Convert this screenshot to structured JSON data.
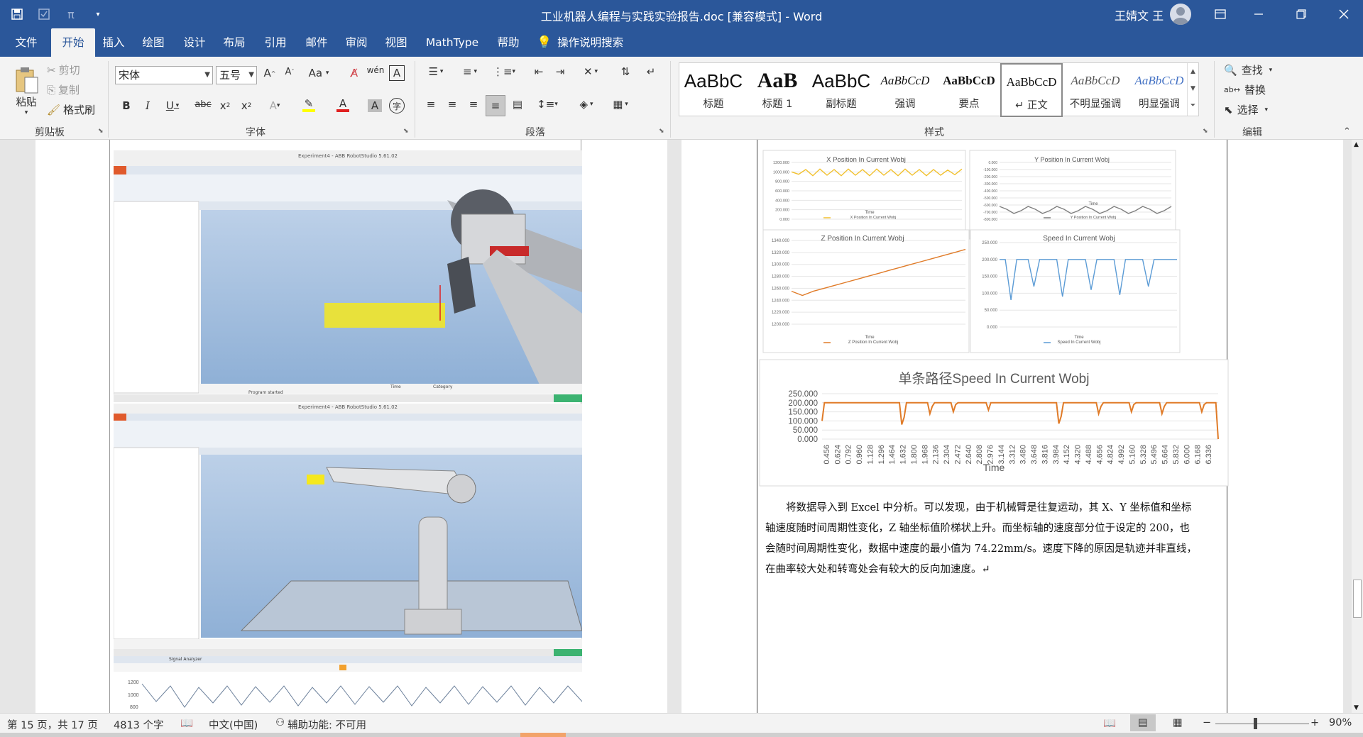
{
  "window": {
    "title": "工业机器人编程与实践实验报告.doc [兼容模式] - Word",
    "user": "王婧文 王",
    "titlebar_color": "#2b579a"
  },
  "menu": [
    "文件",
    "开始",
    "插入",
    "绘图",
    "设计",
    "布局",
    "引用",
    "邮件",
    "审阅",
    "视图",
    "MathType",
    "帮助",
    "操作说明搜索"
  ],
  "ribbon": {
    "clipboard": {
      "paste": "粘贴",
      "cut": "剪切",
      "copy": "复制",
      "format_painter": "格式刷",
      "label": "剪贴板"
    },
    "font": {
      "name": "宋体",
      "size": "五号",
      "label": "字体",
      "change_case": "Aa"
    },
    "paragraph": {
      "label": "段落"
    },
    "styles": {
      "label": "样式",
      "items": [
        {
          "preview": "AaBbC",
          "name": "标题"
        },
        {
          "preview": "AaB",
          "name": "标题 1"
        },
        {
          "preview": "AaBbC",
          "name": "副标题"
        },
        {
          "preview": "AaBbCcD",
          "name": "强调"
        },
        {
          "preview": "AaBbCcD",
          "name": "要点"
        },
        {
          "preview": "AaBbCcD",
          "name": "↵ 正文"
        },
        {
          "preview": "AaBbCcD",
          "name": "不明显强调"
        },
        {
          "preview": "AaBbCcD",
          "name": "明显强调"
        }
      ]
    },
    "editing": {
      "find": "查找",
      "replace": "替换",
      "select": "选择",
      "label": "编辑"
    }
  },
  "left_page": {
    "screenshot1": {
      "title": "Experiment4 - ABB RobotStudio 5.61.02",
      "output_header": [
        "Time",
        "Category"
      ],
      "output_row": "Program started"
    },
    "screenshot2": {
      "title": "Experiment4 - ABB RobotStudio 5.61.02",
      "signal_tab": "Signal Analyzer",
      "y_ticks": [
        "1200",
        "1000",
        "800"
      ]
    }
  },
  "right_page": {
    "charts": [
      {
        "title": "X Position In Current Wobj",
        "legend": "X Position In Current Wobj",
        "xlabel": "Time",
        "y_ticks": [
          "1200.000",
          "1000.000",
          "800.000",
          "600.000",
          "400.000",
          "200.000",
          "0.000"
        ]
      },
      {
        "title": "Y Position In Current Wobj",
        "legend": "Y Position In Current Wobj",
        "xlabel": "Time",
        "y_ticks": [
          "0.000",
          "-100.000",
          "-200.000",
          "-300.000",
          "-400.000",
          "-500.000",
          "-600.000",
          "-700.000",
          "-800.000"
        ]
      },
      {
        "title": "Z Position In Current Wobj",
        "legend": "Z Position In Current Wobj",
        "xlabel": "Time",
        "y_ticks": [
          "1340.000",
          "1320.000",
          "1300.000",
          "1280.000",
          "1260.000",
          "1240.000",
          "1220.000",
          "1200.000"
        ]
      },
      {
        "title": "Speed In Current Wobj",
        "legend": "Speed In Current Wobj",
        "xlabel": "Time",
        "y_ticks": [
          "250.000",
          "200.000",
          "150.000",
          "100.000",
          "50.000",
          "0.000"
        ]
      }
    ],
    "big_chart": {
      "title": "单条路径Speed In Current Wobj",
      "xlabel": "Time",
      "y_ticks": [
        "250.000",
        "200.000",
        "150.000",
        "100.000",
        "50.000",
        "0.000"
      ],
      "x_ticks": [
        "0.456",
        "0.624",
        "0.792",
        "0.960",
        "1.128",
        "1.296",
        "1.464",
        "1.632",
        "1.800",
        "1.968",
        "2.136",
        "2.304",
        "2.472",
        "2.640",
        "2.808",
        "2.976",
        "3.144",
        "3.312",
        "3.480",
        "3.648",
        "3.816",
        "3.984",
        "4.152",
        "4.320",
        "4.488",
        "4.656",
        "4.824",
        "4.992",
        "5.160",
        "5.328",
        "5.496",
        "5.664",
        "5.832",
        "6.000",
        "6.168",
        "6.336"
      ]
    },
    "paragraph": [
      "将数据导入到 Excel 中分析。可以发现，由于机械臂是往复运动，其 X、Y 坐标值和坐标",
      "轴速度随时间周期性变化，Z 轴坐标值阶梯状上升。而坐标轴的速度部分位于设定的 200，也",
      "会随时间周期性变化，数据中速度的最小值为  74.22mm/s。速度下降的原因是轨迹并非直线，",
      "在曲率较大处和转弯处会有较大的反向加速度。↵"
    ]
  },
  "chart_data": [
    {
      "type": "line",
      "title": "X Position In Current Wobj",
      "xlabel": "Time",
      "ylim": [
        0,
        1200
      ],
      "series": [
        {
          "name": "X Position In Current Wobj",
          "color": "#f2c12e",
          "values": [
            1000,
            950,
            1050,
            920,
            1060,
            930,
            1050,
            920,
            1060,
            930,
            1050,
            920,
            1060,
            930,
            1050,
            920,
            1060,
            930,
            1050,
            920,
            1050,
            930,
            1040,
            940,
            1060
          ]
        }
      ]
    },
    {
      "type": "line",
      "title": "Y Position In Current Wobj",
      "xlabel": "Time",
      "ylim": [
        -800,
        0
      ],
      "series": [
        {
          "name": "Y Position In Current Wobj",
          "color": "#7f7f7f",
          "values": [
            -620,
            -660,
            -720,
            -680,
            -620,
            -660,
            -720,
            -680,
            -620,
            -660,
            -720,
            -680,
            -620,
            -660,
            -720,
            -680,
            -620,
            -660,
            -720,
            -680,
            -620,
            -660,
            -720,
            -680,
            -620
          ]
        }
      ]
    },
    {
      "type": "line",
      "title": "Z Position In Current Wobj",
      "xlabel": "Time",
      "ylim": [
        1200,
        1340
      ],
      "series": [
        {
          "name": "Z Position In Current Wobj",
          "color": "#e07b28",
          "values": [
            1255,
            1248,
            1255,
            1260,
            1265,
            1270,
            1275,
            1280,
            1285,
            1290,
            1295,
            1300,
            1305,
            1310,
            1315,
            1320,
            1325
          ]
        }
      ]
    },
    {
      "type": "line",
      "title": "Speed In Current Wobj",
      "xlabel": "Time",
      "ylim": [
        0,
        250
      ],
      "series": [
        {
          "name": "Speed In Current Wobj",
          "color": "#5b9bd5",
          "values": [
            200,
            200,
            80,
            200,
            200,
            200,
            120,
            200,
            200,
            200,
            200,
            90,
            200,
            200,
            200,
            200,
            110,
            200,
            200,
            200,
            200,
            95,
            200,
            200,
            200,
            200,
            120,
            200,
            200,
            200,
            200,
            200
          ]
        }
      ]
    },
    {
      "type": "line",
      "title": "单条路径Speed In Current Wobj",
      "xlabel": "Time",
      "ylim": [
        0,
        250
      ],
      "series": [
        {
          "name": "Speed",
          "color": "#e07b28",
          "values": [
            100,
            200,
            200,
            200,
            200,
            200,
            200,
            200,
            200,
            200,
            200,
            200,
            200,
            200,
            200,
            200,
            200,
            200,
            200,
            200,
            200,
            200,
            200,
            200,
            200,
            200,
            200,
            200,
            200,
            200,
            200,
            200,
            200,
            200,
            200,
            200,
            200,
            200,
            200,
            200,
            200,
            200,
            200,
            200,
            200,
            200,
            200,
            200,
            200,
            200,
            200,
            200,
            200,
            200,
            200,
            200,
            200,
            200,
            200,
            200,
            200,
            200,
            200,
            200,
            200,
            200,
            200,
            200,
            200,
            200,
            200,
            200,
            200,
            200,
            200,
            200,
            200,
            200,
            200,
            200,
            200,
            200,
            200,
            200,
            200,
            200,
            200,
            200,
            200,
            200,
            200,
            200,
            200,
            200,
            200,
            200,
            200,
            200,
            200,
            200,
            200,
            200,
            200,
            200,
            200,
            200,
            200,
            200,
            200,
            200,
            200,
            200,
            200,
            200,
            200,
            200,
            200,
            200,
            200,
            200,
            200,
            200,
            200,
            200,
            200,
            200,
            200,
            200,
            200,
            200,
            200,
            200,
            200,
            200,
            200,
            200,
            200,
            200,
            200,
            200,
            200,
            200,
            200,
            200,
            200,
            200,
            200,
            200,
            200,
            200,
            200,
            200,
            200,
            200,
            200,
            200,
            200,
            200,
            200,
            200,
            200,
            200,
            200,
            200,
            200,
            200,
            200,
            200,
            200,
            0
          ],
          "dips": [
            [
              0.2,
              80
            ],
            [
              0.27,
              140
            ],
            [
              0.33,
              150
            ],
            [
              0.42,
              160
            ],
            [
              0.6,
              85
            ],
            [
              0.7,
              140
            ],
            [
              0.78,
              150
            ],
            [
              0.86,
              140
            ],
            [
              0.96,
              150
            ]
          ]
        }
      ]
    }
  ],
  "status": {
    "page": "第 15 页，共 17 页",
    "words": "4813 个字",
    "lang": "中文(中国)",
    "accessibility": "辅助功能: 不可用",
    "zoom": "90%"
  }
}
